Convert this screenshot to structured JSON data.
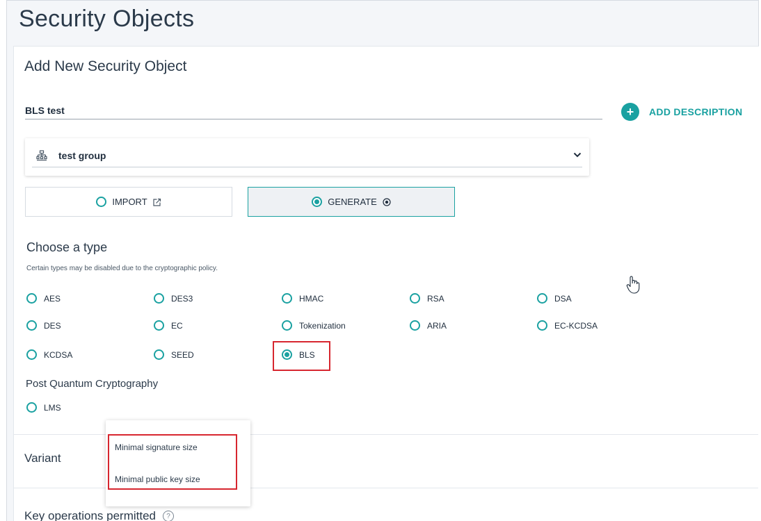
{
  "page": {
    "title": "Security Objects"
  },
  "form": {
    "title": "Add New Security Object",
    "name_value": "BLS test",
    "add_description_label": "ADD DESCRIPTION",
    "group_value": "test group",
    "modes": [
      {
        "label": "IMPORT",
        "selected": false
      },
      {
        "label": "GENERATE",
        "selected": true
      }
    ],
    "choose_type_heading": "Choose a type",
    "choose_type_note": "Certain types may be disabled due to the cryptographic policy.",
    "types": [
      {
        "label": "AES",
        "selected": false
      },
      {
        "label": "DES3",
        "selected": false
      },
      {
        "label": "HMAC",
        "selected": false
      },
      {
        "label": "RSA",
        "selected": false
      },
      {
        "label": "DSA",
        "selected": false
      },
      {
        "label": "DES",
        "selected": false
      },
      {
        "label": "EC",
        "selected": false
      },
      {
        "label": "Tokenization",
        "selected": false
      },
      {
        "label": "ARIA",
        "selected": false
      },
      {
        "label": "EC-KCDSA",
        "selected": false
      },
      {
        "label": "KCDSA",
        "selected": false
      },
      {
        "label": "SEED",
        "selected": false
      },
      {
        "label": "BLS",
        "selected": true
      }
    ],
    "pqc_heading": "Post Quantum Cryptography",
    "pqc_types": [
      {
        "label": "LMS",
        "selected": false
      }
    ],
    "variant_heading": "Variant",
    "variant_options": [
      "Minimal signature size",
      "Minimal public key size"
    ],
    "key_ops_heading": "Key operations permitted"
  },
  "colors": {
    "accent": "#1aa1a1",
    "highlight": "#d7262f"
  },
  "icons": {
    "group": "org-chart-icon",
    "chevron": "chevron-down-icon",
    "add": "plus-circle-icon",
    "import": "import-icon",
    "generate": "generate-icon",
    "help": "help-icon",
    "cursor": "hand-cursor-icon"
  }
}
